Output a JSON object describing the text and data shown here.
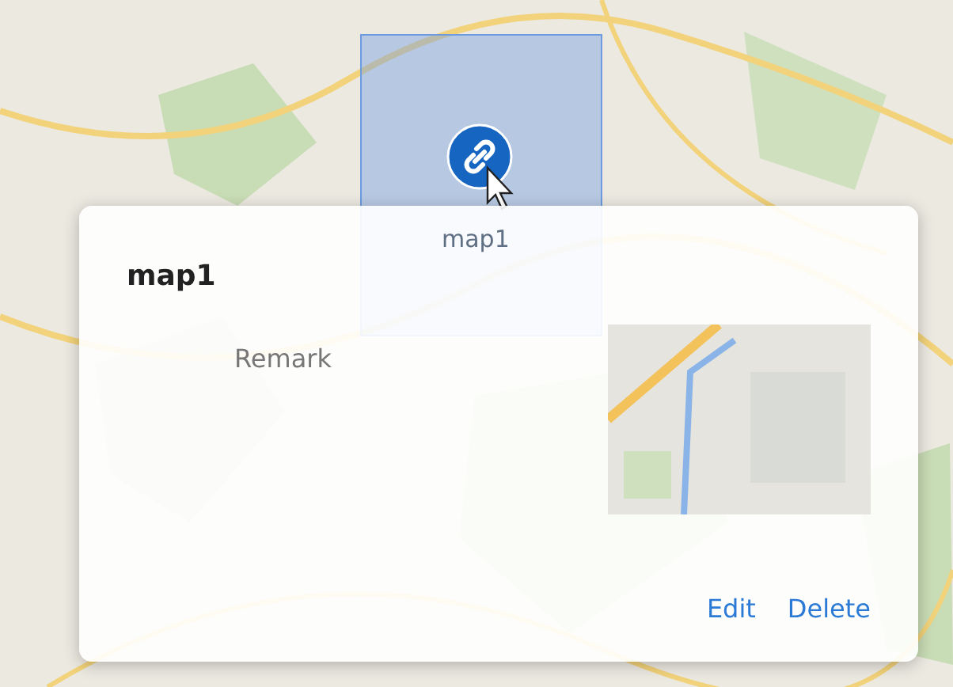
{
  "map": {
    "region_label": "map1"
  },
  "popup": {
    "title": "map1",
    "remark": "Remark",
    "actions": [
      {
        "label": "Edit"
      },
      {
        "label": "Delete"
      }
    ]
  }
}
